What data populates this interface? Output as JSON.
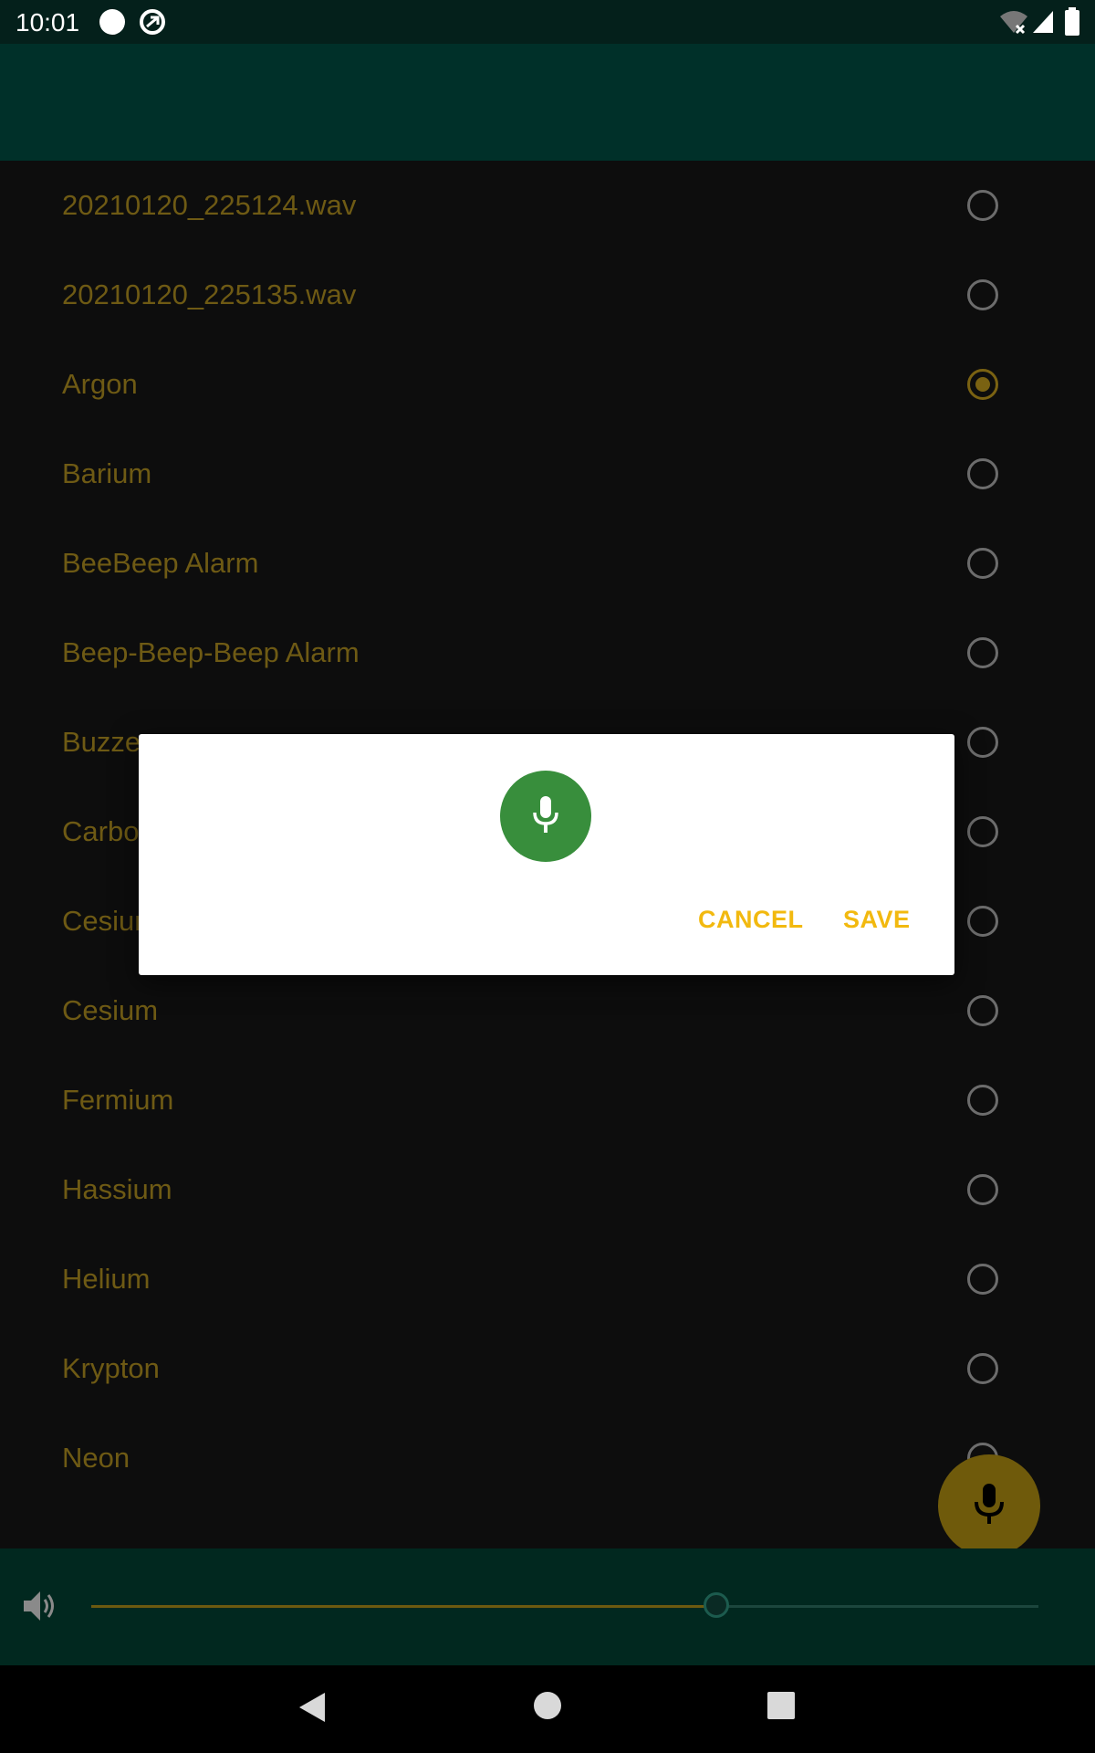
{
  "status_bar": {
    "time": "10:01",
    "icons": [
      "notification-dot-icon",
      "sync-icon",
      "wifi-off-icon",
      "signal-icon",
      "battery-icon"
    ]
  },
  "sounds": [
    {
      "label": "20210120_225124.wav",
      "selected": false
    },
    {
      "label": "20210120_225135.wav",
      "selected": false
    },
    {
      "label": "Argon",
      "selected": true
    },
    {
      "label": "Barium",
      "selected": false
    },
    {
      "label": "BeeBeep Alarm",
      "selected": false
    },
    {
      "label": "Beep-Beep-Beep Alarm",
      "selected": false
    },
    {
      "label": "Buzzer",
      "selected": false
    },
    {
      "label": "Carbon",
      "selected": false
    },
    {
      "label": "Cesium",
      "selected": false
    },
    {
      "label": "Cesium",
      "selected": false
    },
    {
      "label": "Fermium",
      "selected": false
    },
    {
      "label": "Hassium",
      "selected": false
    },
    {
      "label": "Helium",
      "selected": false
    },
    {
      "label": "Krypton",
      "selected": false
    },
    {
      "label": "Neon",
      "selected": false
    }
  ],
  "volume": {
    "level": 0.66
  },
  "dialog": {
    "cancel_label": "CANCEL",
    "save_label": "SAVE"
  },
  "colors": {
    "accent": "#f2b90f",
    "dialog_mic": "#388e3c",
    "appbar": "#003029"
  }
}
